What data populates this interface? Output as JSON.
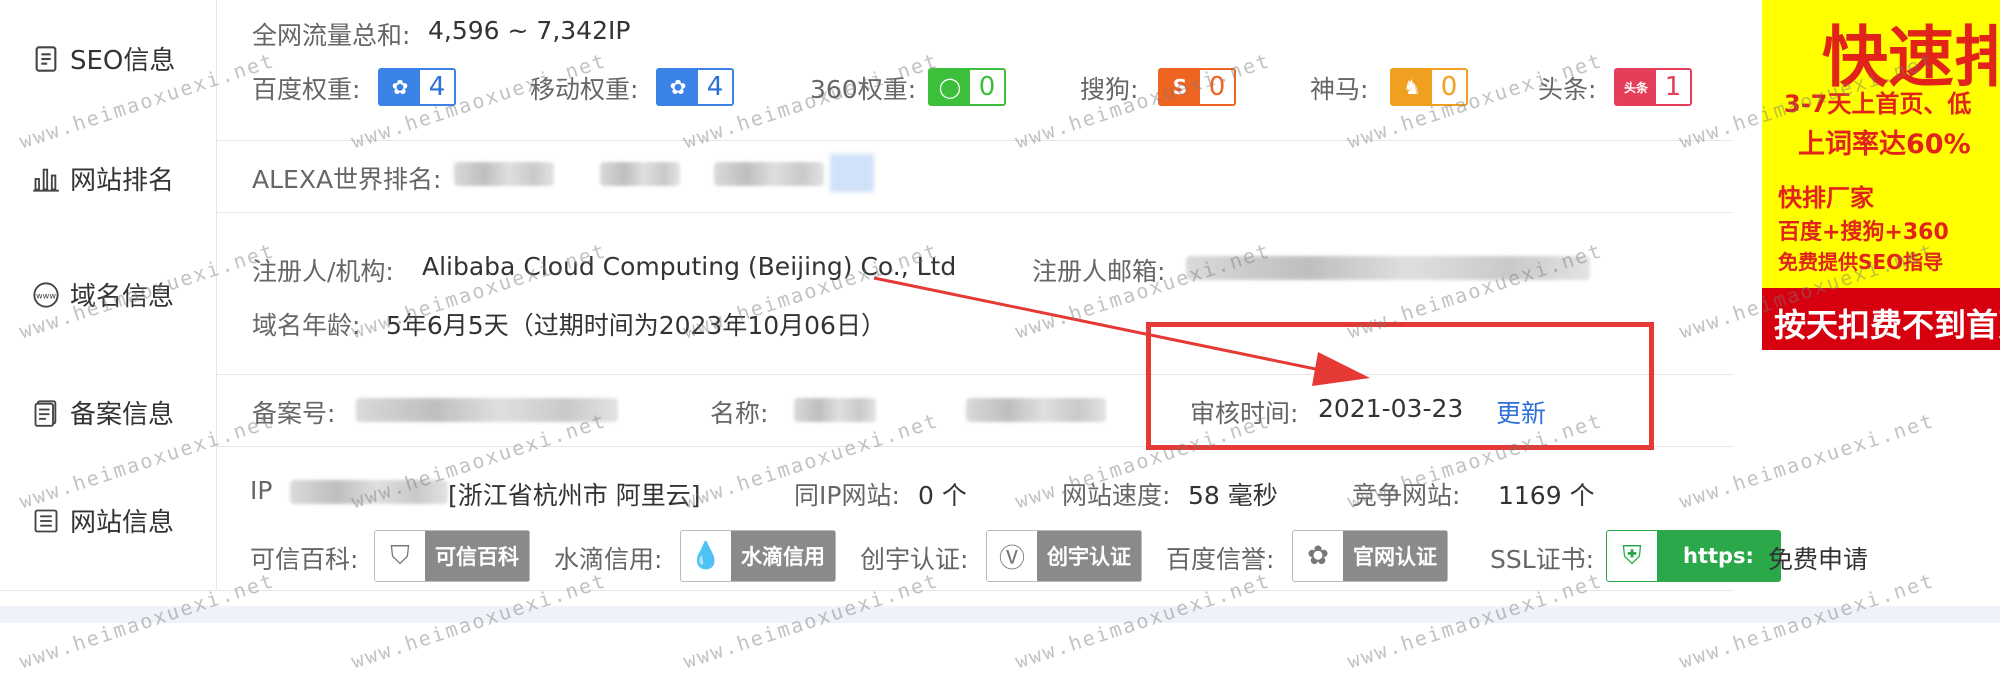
{
  "seo": {
    "label": "SEO信息",
    "traffic_label": "全网流量总和:",
    "traffic_value": "4,596 ~ 7,342IP",
    "weights": [
      {
        "label": "百度权重:",
        "value": "4",
        "color": "#3b82e6",
        "icon": "baidu-paw-icon"
      },
      {
        "label": "移动权重:",
        "value": "4",
        "color": "#3b82e6",
        "icon": "baidu-paw-icon"
      },
      {
        "label": "360权重:",
        "value": "0",
        "color": "#3cc03c",
        "icon": "360-ring-icon"
      },
      {
        "label": "搜狗:",
        "value": "0",
        "color": "#f06422",
        "icon": "sogou-s-icon"
      },
      {
        "label": "神马:",
        "value": "0",
        "color": "#f0a020",
        "icon": "shenma-horse-icon"
      },
      {
        "label": "头条:",
        "value": "1",
        "color": "#e53e5a",
        "icon": "toutiao-icon"
      }
    ]
  },
  "rank": {
    "label": "网站排名",
    "alexa_label": "ALEXA世界排名:"
  },
  "domain": {
    "label": "域名信息",
    "registrant_label": "注册人/机构:",
    "registrant_value": "Alibaba Cloud Computing (Beijing) Co., Ltd",
    "email_label": "注册人邮箱:",
    "age_label": "域名年龄:",
    "age_value": "5年6月5天（过期时间为2023年10月06日）"
  },
  "icp": {
    "label": "备案信息",
    "number_label": "备案号:",
    "name_label": "名称:",
    "review_label": "审核时间:",
    "review_value": "2021-03-23",
    "update_link": "更新"
  },
  "site": {
    "label": "网站信息",
    "ip_label": "IP",
    "ip_location": "[浙江省杭州市 阿里云]",
    "same_ip_label": "同IP网站:",
    "same_ip_value": "0 个",
    "speed_label": "网站速度:",
    "speed_value": "58 毫秒",
    "compete_label": "竞争网站:",
    "compete_value": "1169 个",
    "certs": [
      {
        "label": "可信百科:",
        "badge": "可信百科"
      },
      {
        "label": "水滴信用:",
        "badge": "水滴信用"
      },
      {
        "label": "创宇认证:",
        "badge": "创宇认证"
      },
      {
        "label": "百度信誉:",
        "badge": "官网认证"
      }
    ],
    "ssl_label": "SSL证书:",
    "ssl_badge": "https:",
    "ssl_action": "免费申请"
  },
  "ad": {
    "headline": "快速排",
    "line1": "3-7天上首页、低",
    "line2": "上词率达60%",
    "line3": "快排厂家",
    "line4": "百度+搜狗+360",
    "line5": "免费提供SEO指导",
    "bar": "按天扣费不到首页"
  },
  "watermark": "www.heimaoxuexi.net",
  "colors": {
    "annotation_red": "#e53935",
    "link_blue": "#2f6fd8"
  }
}
